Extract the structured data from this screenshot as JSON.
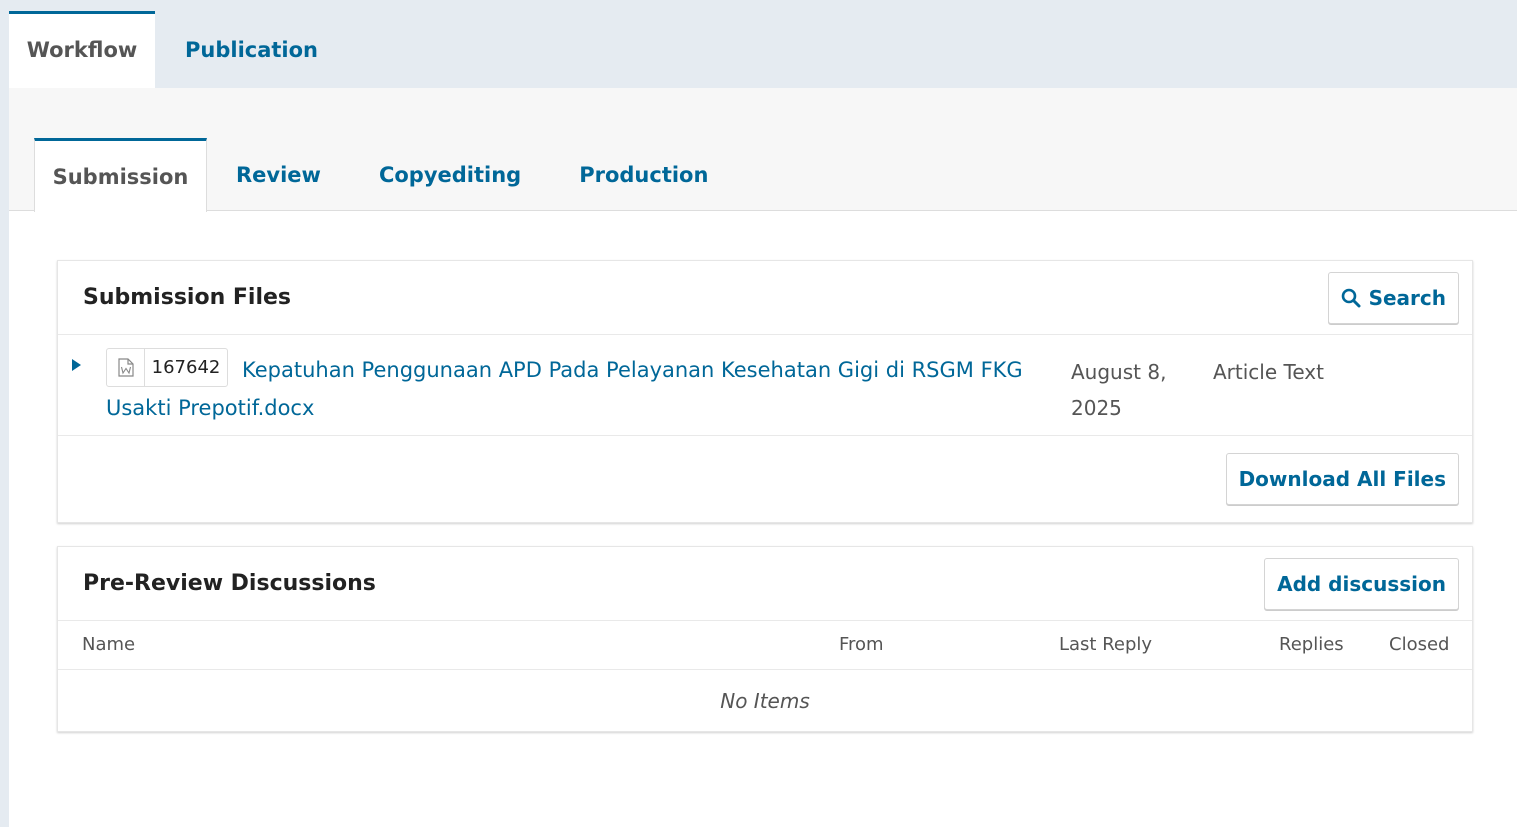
{
  "top_tabs": [
    {
      "label": "Workflow",
      "active": true
    },
    {
      "label": "Publication",
      "active": false
    }
  ],
  "stage_tabs": [
    {
      "label": "Submission",
      "active": true
    },
    {
      "label": "Review",
      "active": false
    },
    {
      "label": "Copyediting",
      "active": false
    },
    {
      "label": "Production",
      "active": false
    }
  ],
  "submission_files": {
    "title": "Submission Files",
    "search_label": "Search",
    "file": {
      "id": "167642",
      "name": "Kepatuhan Penggunaan APD Pada Pelayanan Kesehatan Gigi di RSGM FKG Usakti Prepotif.docx",
      "date": "August 8, 2025",
      "type": "Article Text",
      "icon": "document-icon"
    },
    "download_all_label": "Download All Files"
  },
  "discussions": {
    "title": "Pre-Review Discussions",
    "add_label": "Add discussion",
    "columns": [
      "Name",
      "From",
      "Last Reply",
      "Replies",
      "Closed"
    ],
    "empty_text": "No Items"
  },
  "colors": {
    "accent": "#006798",
    "background": "#e5ebf1"
  }
}
